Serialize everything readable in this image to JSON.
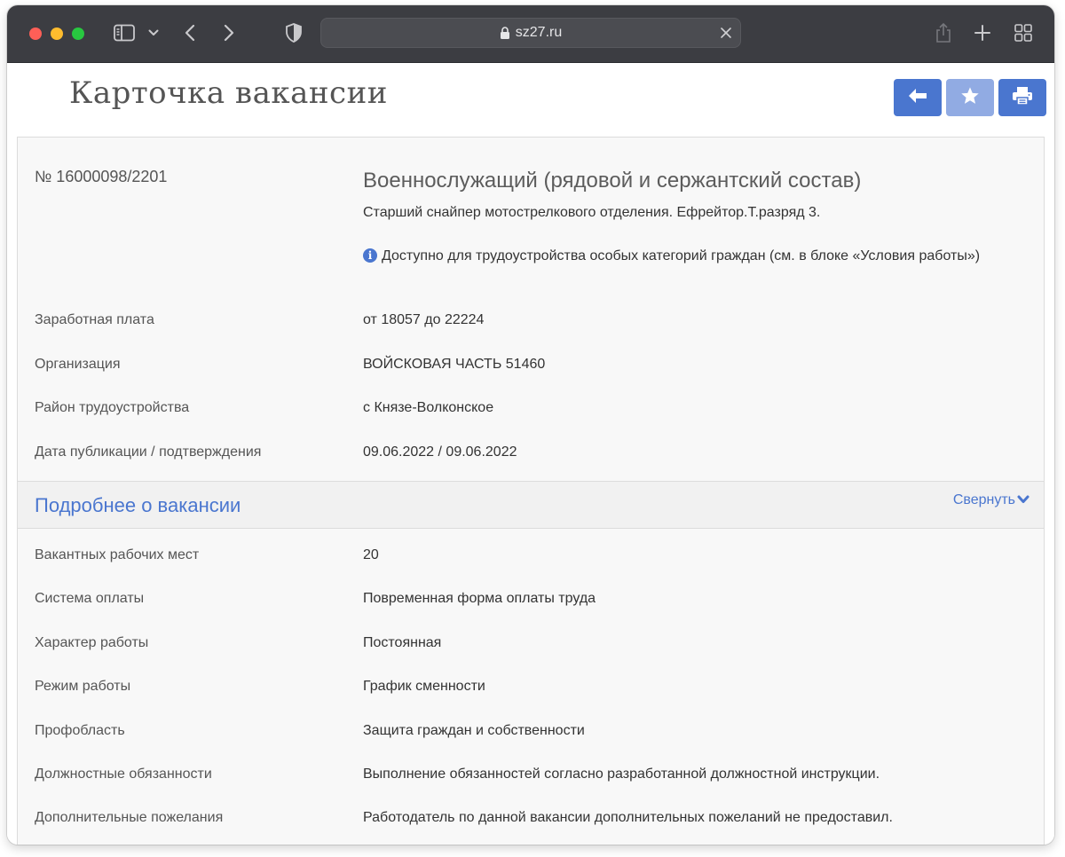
{
  "browser": {
    "url": "sz27.ru"
  },
  "page": {
    "title": "Карточка вакансии"
  },
  "vacancy": {
    "number": "№ 16000098/2201",
    "title": "Военнослужащий (рядовой и сержантский состав)",
    "subtitle": "Старший снайпер мотострелкового отделения. Ефрейтор.Т.разряд 3.",
    "note": "Доступно для трудоустройства особых категорий граждан (см. в блоке «Условия работы»)",
    "rows": [
      {
        "label": "Заработная плата",
        "value": "от 18057 до 22224"
      },
      {
        "label": "Организация",
        "value": "ВОЙСКОВАЯ ЧАСТЬ 51460"
      },
      {
        "label": "Район трудоустройства",
        "value": "с Князе-Волконское"
      },
      {
        "label": "Дата публикации / подтверждения",
        "value": "09.06.2022 / 09.06.2022"
      }
    ]
  },
  "details": {
    "title": "Подробнее о вакансии",
    "collapse_label": "Свернуть",
    "rows": [
      {
        "label": "Вакантных рабочих мест",
        "value": "20"
      },
      {
        "label": "Система оплаты",
        "value": "Повременная форма оплаты труда"
      },
      {
        "label": "Характер работы",
        "value": "Постоянная"
      },
      {
        "label": "Режим работы",
        "value": "График сменности"
      },
      {
        "label": "Профобласть",
        "value": "Защита граждан и собственности"
      },
      {
        "label": "Должностные обязанности",
        "value": "Выполнение обязанностей согласно разработанной должностной инструкции."
      },
      {
        "label": "Дополнительные пожелания",
        "value": "Работодатель по данной вакансии дополнительных пожеланий не предоставил."
      }
    ]
  },
  "colors": {
    "accent": "#4a76cf",
    "accent_light": "#91abe3",
    "toolbar": "#3c3d42"
  },
  "icons": {
    "back_button": "arrow-left-icon",
    "favorite_button": "star-icon",
    "print_button": "printer-icon"
  }
}
